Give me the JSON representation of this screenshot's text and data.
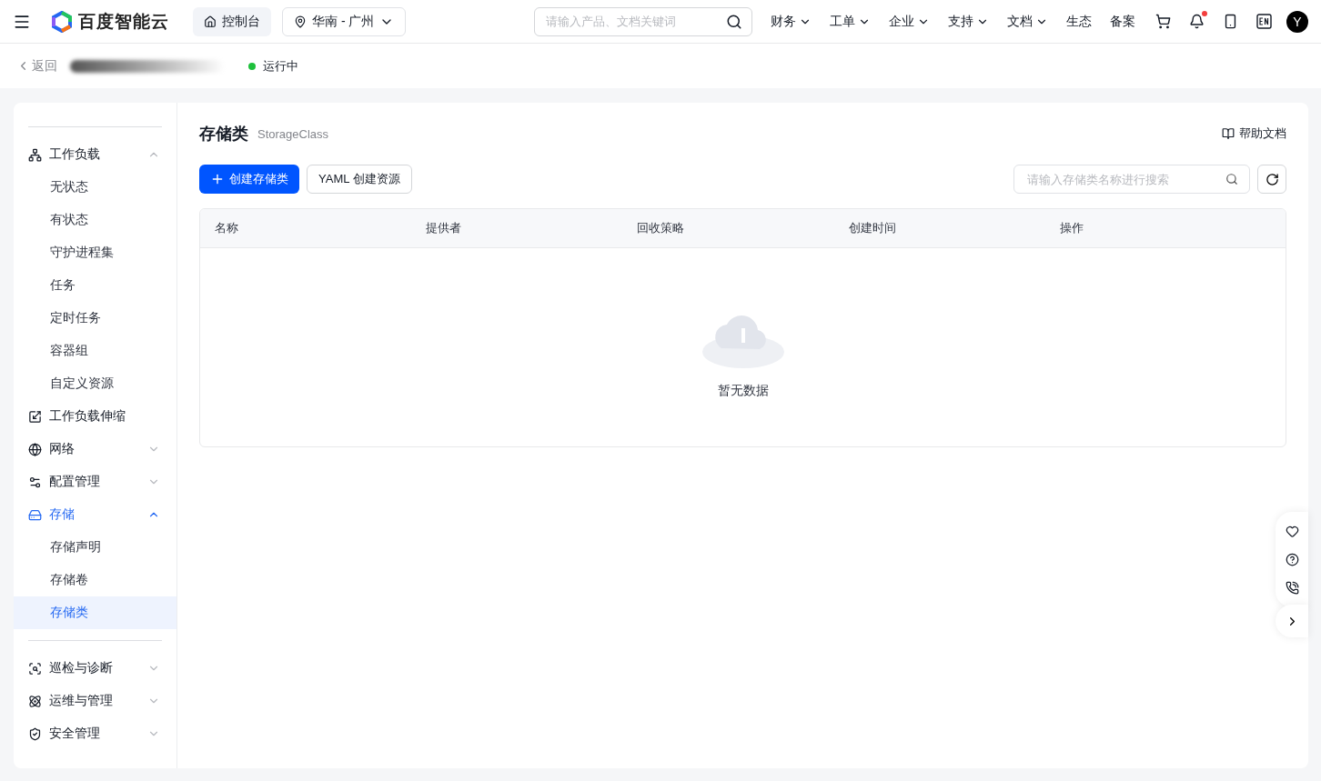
{
  "header": {
    "logo": "百度智能云",
    "console": "控制台",
    "region": "华南 - 广州",
    "search": {
      "placeholder": "请输入产品、文档关键词"
    },
    "nav": [
      {
        "label": "财务",
        "dropdown": true
      },
      {
        "label": "工单",
        "dropdown": true
      },
      {
        "label": "企业",
        "dropdown": true
      },
      {
        "label": "支持",
        "dropdown": true
      },
      {
        "label": "文档",
        "dropdown": true
      },
      {
        "label": "生态",
        "dropdown": false
      },
      {
        "label": "备案",
        "dropdown": false
      }
    ],
    "notifications_unread": true,
    "avatar": "Y"
  },
  "subheader": {
    "back": "返回",
    "status": {
      "label": "运行中",
      "color": "#1ec03c"
    }
  },
  "sidebar": {
    "items": [
      {
        "kind": "divider"
      },
      {
        "kind": "group",
        "label": "工作负载",
        "expanded": true,
        "selected": false,
        "children": [
          {
            "label": "无状态",
            "selected": false
          },
          {
            "label": "有状态",
            "selected": false
          },
          {
            "label": "守护进程集",
            "selected": false
          },
          {
            "label": "任务",
            "selected": false
          },
          {
            "label": "定时任务",
            "selected": false
          },
          {
            "label": "容器组",
            "selected": false
          },
          {
            "label": "自定义资源",
            "selected": false
          }
        ]
      },
      {
        "kind": "link",
        "label": "工作负载伸缩",
        "selected": false
      },
      {
        "kind": "group",
        "label": "网络",
        "expanded": false,
        "selected": false
      },
      {
        "kind": "group",
        "label": "配置管理",
        "expanded": false,
        "selected": false
      },
      {
        "kind": "group",
        "label": "存储",
        "expanded": true,
        "selected": true,
        "children": [
          {
            "label": "存储声明",
            "selected": false
          },
          {
            "label": "存储卷",
            "selected": false
          },
          {
            "label": "存储类",
            "selected": true
          }
        ]
      },
      {
        "kind": "divider"
      },
      {
        "kind": "group",
        "label": "巡检与诊断",
        "expanded": false,
        "selected": false
      },
      {
        "kind": "group",
        "label": "运维与管理",
        "expanded": false,
        "selected": false
      },
      {
        "kind": "group",
        "label": "安全管理",
        "expanded": false,
        "selected": false
      }
    ]
  },
  "page": {
    "title": "存储类",
    "subtitle": "StorageClass",
    "help": "帮助文档",
    "create_button": "创建存储类",
    "yaml_button": "YAML 创建资源",
    "search": {
      "placeholder": "请输入存储类名称进行搜索"
    },
    "table": {
      "columns": [
        "名称",
        "提供者",
        "回收策略",
        "创建时间",
        "操作"
      ],
      "empty": "暂无数据"
    }
  }
}
